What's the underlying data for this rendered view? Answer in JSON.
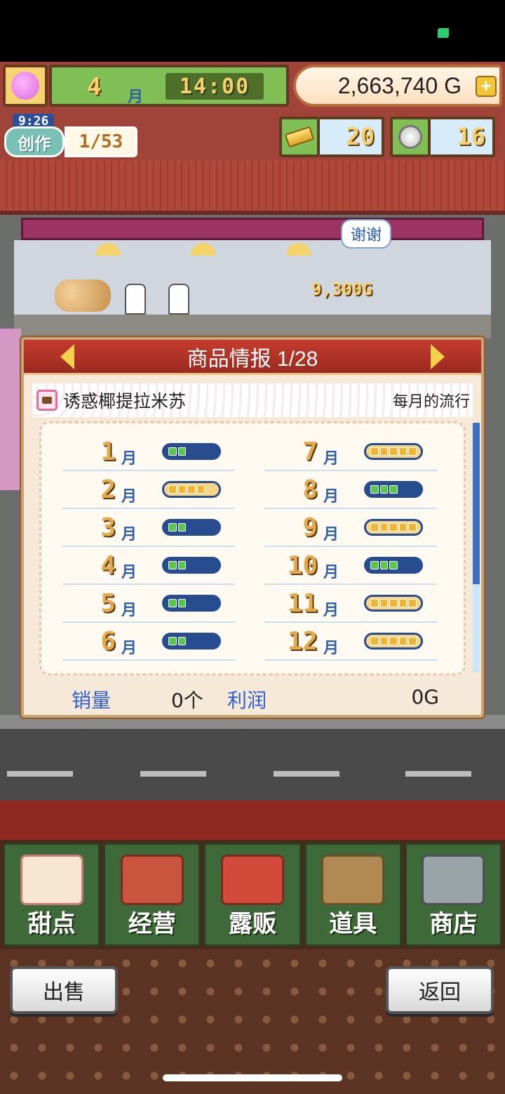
{
  "hud": {
    "month": "4",
    "month_unit": "月",
    "time": "14:00",
    "money": "2,663,740 G",
    "create_timer": "9:26",
    "create_label": "创作",
    "create_count": "1/53",
    "gold": "20",
    "medals": "16"
  },
  "scene": {
    "thanks_bubble": "谢谢",
    "sale_popup": "9,300G"
  },
  "panel": {
    "title": "商品情报 1/28",
    "item_name": "诱惑椰提拉米苏",
    "trend_label": "每月的流行",
    "months_left": [
      {
        "num": "1",
        "unit": "月",
        "level": 2
      },
      {
        "num": "2",
        "unit": "月",
        "level": 4
      },
      {
        "num": "3",
        "unit": "月",
        "level": 2
      },
      {
        "num": "4",
        "unit": "月",
        "level": 2
      },
      {
        "num": "5",
        "unit": "月",
        "level": 2
      },
      {
        "num": "6",
        "unit": "月",
        "level": 2
      }
    ],
    "months_right": [
      {
        "num": "7",
        "unit": "月",
        "level": 5
      },
      {
        "num": "8",
        "unit": "月",
        "level": 3
      },
      {
        "num": "9",
        "unit": "月",
        "level": 5
      },
      {
        "num": "10",
        "unit": "月",
        "level": 3
      },
      {
        "num": "11",
        "unit": "月",
        "level": 5
      },
      {
        "num": "12",
        "unit": "月",
        "level": 5
      }
    ],
    "sales_label": "销量",
    "sales_value": "0个",
    "profit_label": "利润",
    "profit_value": "0G"
  },
  "nav": [
    {
      "label": "甜点",
      "icon": "cake-icon"
    },
    {
      "label": "经营",
      "icon": "shop-icon"
    },
    {
      "label": "露贩",
      "icon": "food-truck-icon"
    },
    {
      "label": "道具",
      "icon": "items-icon"
    },
    {
      "label": "商店",
      "icon": "cart-icon"
    }
  ],
  "buttons": {
    "sell": "出售",
    "back": "返回"
  },
  "colors": {
    "meter_green": "#58c84a",
    "meter_yellow": "#f2b531",
    "panel_header": "#b5332a"
  }
}
